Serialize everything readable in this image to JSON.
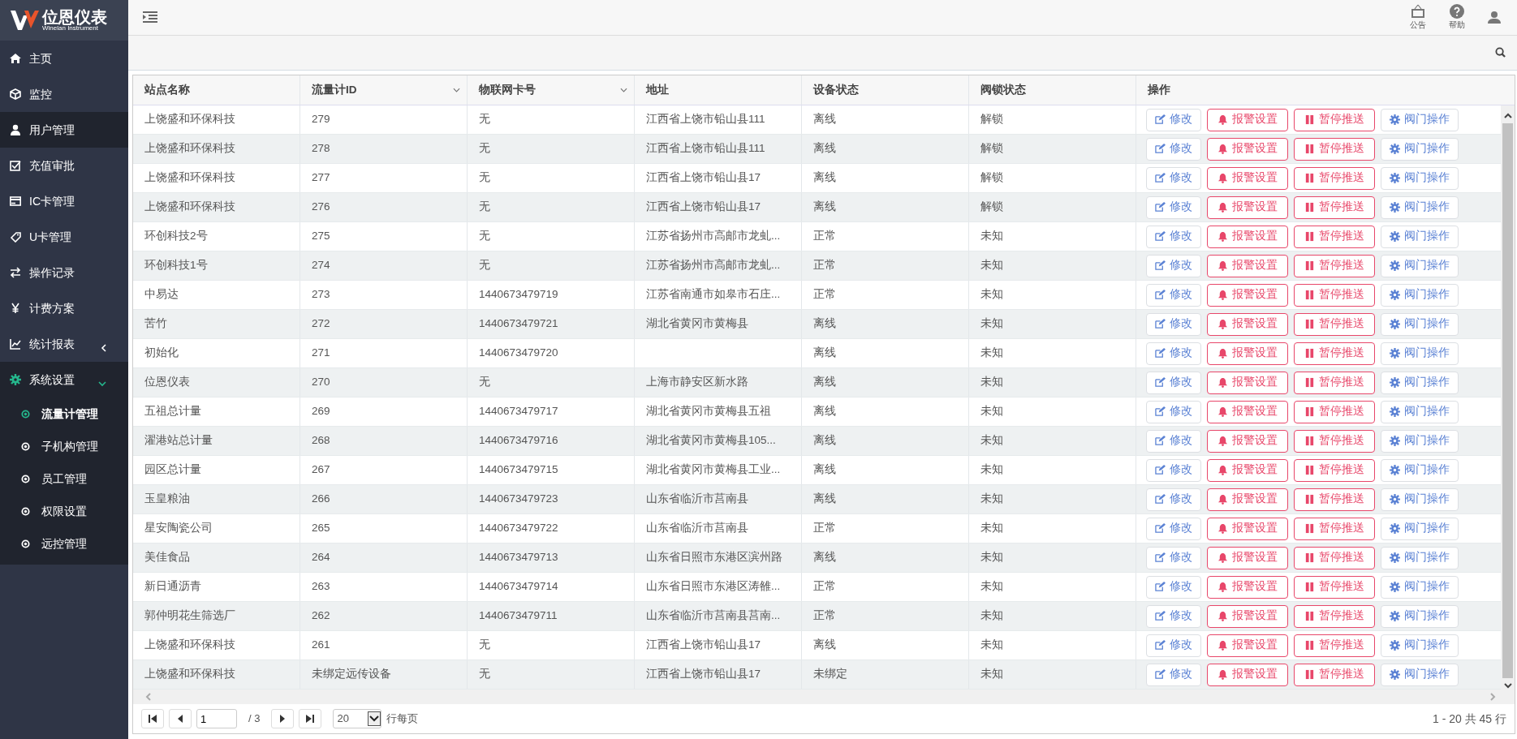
{
  "brand": {
    "name": "位恩仪表",
    "subtitle": "Winelan Instrument"
  },
  "sidebar": {
    "items": [
      {
        "label": "主页",
        "selected": false,
        "expanded": false,
        "submenu": false
      },
      {
        "label": "监控",
        "selected": false,
        "expanded": false,
        "submenu": false
      },
      {
        "label": "用户管理",
        "selected": true,
        "expanded": false,
        "submenu": false
      },
      {
        "label": "充值审批",
        "selected": false,
        "expanded": false,
        "submenu": false
      },
      {
        "label": "IC卡管理",
        "selected": false,
        "expanded": false,
        "submenu": false
      },
      {
        "label": "U卡管理",
        "selected": false,
        "expanded": false,
        "submenu": false
      },
      {
        "label": "操作记录",
        "selected": false,
        "expanded": false,
        "submenu": false
      },
      {
        "label": "计费方案",
        "selected": false,
        "expanded": false,
        "submenu": false
      },
      {
        "label": "统计报表",
        "selected": false,
        "expanded": false,
        "submenu": true
      },
      {
        "label": "系统设置",
        "selected": false,
        "expanded": true,
        "submenu": true,
        "children": [
          {
            "label": "流量计管理",
            "selected": true
          },
          {
            "label": "子机构管理",
            "selected": false
          },
          {
            "label": "员工管理",
            "selected": false
          },
          {
            "label": "权限设置",
            "selected": false
          },
          {
            "label": "远控管理",
            "selected": false
          }
        ]
      }
    ]
  },
  "header": {
    "actions": [
      "公告",
      "帮助"
    ]
  },
  "table": {
    "columns": [
      {
        "label": "站点名称",
        "sortable": false
      },
      {
        "label": "流量计ID",
        "sortable": true
      },
      {
        "label": "物联网卡号",
        "sortable": true
      },
      {
        "label": "地址",
        "sortable": false
      },
      {
        "label": "设备状态",
        "sortable": false
      },
      {
        "label": "阀锁状态",
        "sortable": false
      },
      {
        "label": "操作",
        "sortable": false
      }
    ],
    "rows": [
      {
        "name": "上饶盛和环保科技",
        "meter_id": "279",
        "card": "无",
        "address": "江西省上饶市铅山县111",
        "status": "离线",
        "lock": "解锁",
        "actions": [
          "修改",
          "报警设置",
          "暂停推送",
          "阀门操作"
        ]
      },
      {
        "name": "上饶盛和环保科技",
        "meter_id": "278",
        "card": "无",
        "address": "江西省上饶市铅山县111",
        "status": "离线",
        "lock": "解锁",
        "actions": [
          "修改",
          "报警设置",
          "暂停推送",
          "阀门操作"
        ]
      },
      {
        "name": "上饶盛和环保科技",
        "meter_id": "277",
        "card": "无",
        "address": "江西省上饶市铅山县17",
        "status": "离线",
        "lock": "解锁",
        "actions": [
          "修改",
          "报警设置",
          "暂停推送",
          "阀门操作"
        ]
      },
      {
        "name": "上饶盛和环保科技",
        "meter_id": "276",
        "card": "无",
        "address": "江西省上饶市铅山县17",
        "status": "离线",
        "lock": "解锁",
        "actions": [
          "修改",
          "报警设置",
          "暂停推送",
          "阀门操作"
        ]
      },
      {
        "name": "环创科技2号",
        "meter_id": "275",
        "card": "无",
        "address": "江苏省扬州市高邮市龙虬...",
        "status": "正常",
        "lock": "未知",
        "actions": [
          "修改",
          "报警设置",
          "暂停推送",
          "阀门操作"
        ]
      },
      {
        "name": "环创科技1号",
        "meter_id": "274",
        "card": "无",
        "address": "江苏省扬州市高邮市龙虬...",
        "status": "正常",
        "lock": "未知",
        "actions": [
          "修改",
          "报警设置",
          "暂停推送",
          "阀门操作"
        ]
      },
      {
        "name": "中易达",
        "meter_id": "273",
        "card": "1440673479719",
        "address": "江苏省南通市如皋市石庄...",
        "status": "正常",
        "lock": "未知",
        "actions": [
          "修改",
          "报警设置",
          "暂停推送",
          "阀门操作"
        ]
      },
      {
        "name": "苦竹",
        "meter_id": "272",
        "card": "1440673479721",
        "address": "湖北省黄冈市黄梅县",
        "status": "离线",
        "lock": "未知",
        "actions": [
          "修改",
          "报警设置",
          "暂停推送",
          "阀门操作"
        ]
      },
      {
        "name": "初始化",
        "meter_id": "271",
        "card": "1440673479720",
        "status": "离线",
        "lock": "未知",
        "actions": [
          "修改",
          "报警设置",
          "暂停推送",
          "阀门操作"
        ]
      },
      {
        "name": "位恩仪表",
        "meter_id": "270",
        "card": "无",
        "address": "上海市静安区新水路",
        "status": "离线",
        "lock": "未知",
        "actions": [
          "修改",
          "报警设置",
          "暂停推送",
          "阀门操作"
        ]
      },
      {
        "name": "五祖总计量",
        "meter_id": "269",
        "card": "1440673479717",
        "address": "湖北省黄冈市黄梅县五祖",
        "status": "离线",
        "lock": "未知",
        "actions": [
          "修改",
          "报警设置",
          "暂停推送",
          "阀门操作"
        ]
      },
      {
        "name": "濯港站总计量",
        "meter_id": "268",
        "card": "1440673479716",
        "address": "湖北省黄冈市黄梅县105...",
        "status": "离线",
        "lock": "未知",
        "actions": [
          "修改",
          "报警设置",
          "暂停推送",
          "阀门操作"
        ]
      },
      {
        "name": "园区总计量",
        "meter_id": "267",
        "card": "1440673479715",
        "address": "湖北省黄冈市黄梅县工业...",
        "status": "离线",
        "lock": "未知",
        "actions": [
          "修改",
          "报警设置",
          "暂停推送",
          "阀门操作"
        ]
      },
      {
        "name": "玉皇粮油",
        "meter_id": "266",
        "card": "1440673479723",
        "address": "山东省临沂市莒南县",
        "status": "离线",
        "lock": "未知",
        "actions": [
          "修改",
          "报警设置",
          "暂停推送",
          "阀门操作"
        ]
      },
      {
        "name": "星安陶瓷公司",
        "meter_id": "265",
        "card": "1440673479722",
        "address": "山东省临沂市莒南县",
        "status": "正常",
        "lock": "未知",
        "actions": [
          "修改",
          "报警设置",
          "暂停推送",
          "阀门操作"
        ]
      },
      {
        "name": "美佳食品",
        "meter_id": "264",
        "card": "1440673479713",
        "address": "山东省日照市东港区滨州路",
        "status": "离线",
        "lock": "未知",
        "actions": [
          "修改",
          "报警设置",
          "暂停推送",
          "阀门操作"
        ]
      },
      {
        "name": "新日通沥青",
        "meter_id": "263",
        "card": "1440673479714",
        "address": "山东省日照市东港区涛雒...",
        "status": "正常",
        "lock": "未知",
        "actions": [
          "修改",
          "报警设置",
          "暂停推送",
          "阀门操作"
        ]
      },
      {
        "name": "郭仲明花生筛选厂",
        "meter_id": "262",
        "card": "1440673479711",
        "address": "山东省临沂市莒南县莒南...",
        "status": "正常",
        "lock": "未知",
        "actions": [
          "修改",
          "报警设置",
          "暂停推送",
          "阀门操作"
        ]
      },
      {
        "name": "上饶盛和环保科技",
        "meter_id": "261",
        "card": "无",
        "address": "江西省上饶市铅山县17",
        "status": "离线",
        "lock": "未知",
        "actions": [
          "修改",
          "报警设置",
          "暂停推送",
          "阀门操作"
        ]
      },
      {
        "name": "上饶盛和环保科技",
        "meter_id": "未绑定远传设备",
        "card": "无",
        "address": "江西省上饶市铅山县17",
        "status": "未绑定",
        "lock": "未知",
        "actions": [
          "修改",
          "报警设置",
          "暂停推送",
          "阀门操作"
        ]
      }
    ]
  },
  "pagination": {
    "page": "1",
    "total_pages": "/ 3",
    "page_size": "20",
    "page_size_label": "行每页",
    "summary": "1 - 20 共 45 行"
  }
}
